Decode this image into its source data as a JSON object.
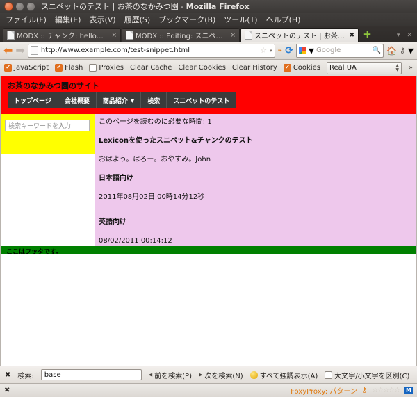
{
  "window": {
    "title": "スニペットのテスト | お茶のなかみつ園",
    "app_name": "Mozilla Firefox",
    "separator": " - ",
    "close_label": "×",
    "minimize_label": "−",
    "maximize_label": "□"
  },
  "menubar": {
    "items": [
      {
        "label": "ファイル(F)"
      },
      {
        "label": "編集(E)"
      },
      {
        "label": "表示(V)"
      },
      {
        "label": "履歴(S)"
      },
      {
        "label": "ブックマーク(B)"
      },
      {
        "label": "ツール(T)"
      },
      {
        "label": "ヘルプ(H)"
      }
    ]
  },
  "tabs": {
    "items": [
      {
        "label": "MODX :: チャンク: helloworld",
        "close": "×",
        "active": false
      },
      {
        "label": "MODX :: Editing: スニペット...",
        "close": "×",
        "active": false
      },
      {
        "label": "スニペットのテスト | お茶のな...",
        "close": "✖",
        "active": true
      }
    ],
    "new_tab_label": "+",
    "list_all_label": "▾",
    "close_all_label": "✕"
  },
  "navbar": {
    "back_label": "⬅",
    "forward_label": "➡",
    "url": "http://www.example.com/test-snippet.html",
    "bookmark_star": "☆",
    "url_dropdown": "▾",
    "rss_label": "⌁",
    "reload_label": "⟳",
    "search_engine": "Google",
    "search_engine_dropdown": "▾",
    "search_magnifier": "🔍",
    "home_label": "🏠",
    "extension_label": "⚷",
    "overflow_label": "▾"
  },
  "devbar": {
    "javascript": {
      "label": "JavaScript",
      "checked": true
    },
    "flash": {
      "label": "Flash",
      "checked": true
    },
    "proxies": {
      "label": "Proxies",
      "checked": false
    },
    "clear_cache": "Clear Cache",
    "clear_cookies": "Clear Cookies",
    "clear_history": "Clear History",
    "cookies": {
      "label": "Cookies",
      "checked": true
    },
    "user_agent": "Real UA",
    "overflow_label": "»"
  },
  "page": {
    "site_title": "お茶のなかみつ園のサイト",
    "nav": [
      {
        "label": "トップページ",
        "has_caret": false
      },
      {
        "label": "会社概要",
        "has_caret": false
      },
      {
        "label": "商品紹介",
        "has_caret": true
      },
      {
        "label": "検索",
        "has_caret": false
      },
      {
        "label": "スニペットのテスト",
        "has_caret": false
      }
    ],
    "nav_caret": "▼",
    "sidebar": {
      "search_placeholder": "検索キーワードを入力",
      "search_value": ""
    },
    "content": {
      "read_time": "このページを読むのに必要な時間: 1",
      "heading": "Lexiconを使ったスニペット&チャンクのテスト",
      "greeting": "おはよう。はろー。おやすみ。John",
      "japanese_label": "日本語向け",
      "japanese_date": "2011年08月02日 00時14分12秒",
      "english_label": "英語向け",
      "english_date": "08/02/2011 00:14:12"
    },
    "footer": "ここはフッタです。",
    "colors": {
      "header_bg": "#ff0000",
      "nav_bg": "#3b3b3b",
      "sidebar_bg": "#ffff00",
      "content_bg": "#eec8ec",
      "footer_bg": "#008000"
    }
  },
  "findbar": {
    "close_label": "✖",
    "label": "検索:",
    "value": "base",
    "previous": "前を検索(P)",
    "previous_arrow": "◀",
    "next": "次を検索(N)",
    "next_arrow": "▶",
    "highlight_all": "すべて強調表示(A)",
    "match_case": "大文字/小文字を区別(C)",
    "match_case_checked": false
  },
  "statusbar": {
    "close_label": "✖",
    "foxyproxy": "FoxyProxy: パターン",
    "stars": "☆☆☆☆☆",
    "extension_label": "⚷",
    "badge": "M"
  }
}
